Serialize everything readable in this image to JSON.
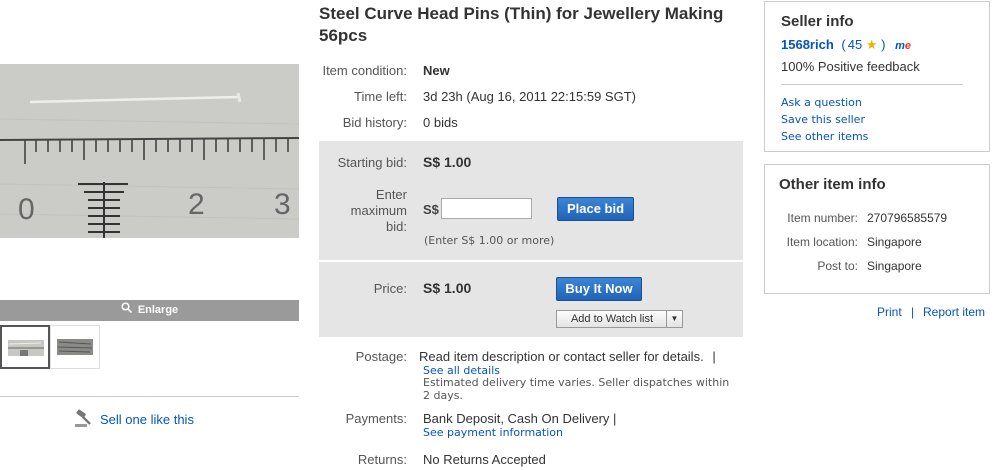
{
  "left": {
    "enlarge_label": "Enlarge",
    "sell_label": "Sell one like this"
  },
  "item": {
    "title": "Steel Curve Head Pins (Thin) for Jewellery Making 56pcs",
    "condition_label": "Item condition:",
    "condition_value": "New",
    "time_left_label": "Time left:",
    "time_left_value": "3d 23h (Aug 16, 2011 22:15:59 SGT)",
    "bid_history_label": "Bid history:",
    "bid_history_value": "0 bids"
  },
  "bid": {
    "starting_label": "Starting bid:",
    "starting_value": "S$ 1.00",
    "enter_label_1": "Enter",
    "enter_label_2": "maximum",
    "enter_label_3": "bid:",
    "currency": "S$",
    "input_value": "",
    "hint": "(Enter S$ 1.00 or more)",
    "place_bid": "Place bid"
  },
  "price": {
    "label": "Price:",
    "value": "S$ 1.00",
    "buy_now": "Buy It Now",
    "watch": "Add to Watch list"
  },
  "postage": {
    "label": "Postage:",
    "value": "Read item description or contact seller for details.",
    "sep": "|",
    "link": "See all details",
    "note": "Estimated delivery time varies. Seller dispatches within 2 days."
  },
  "payments": {
    "label": "Payments:",
    "value": "Bank Deposit, Cash On Delivery |",
    "link": "See payment information"
  },
  "returns": {
    "label": "Returns:",
    "value": "No Returns Accepted"
  },
  "seller": {
    "heading": "Seller info",
    "name": "1568rich",
    "paren_open": "(",
    "score": "45",
    "star": "★",
    "paren_close": ")",
    "me_badge": "me",
    "feedback": "100% Positive feedback",
    "links": [
      "Ask a question",
      "Save this seller",
      "See other items"
    ]
  },
  "other": {
    "heading": "Other item info",
    "number_label": "Item number:",
    "number_value": "270796585579",
    "location_label": "Item location:",
    "location_value": "Singapore",
    "post_label": "Post to:",
    "post_value": "Singapore"
  },
  "footer": {
    "print": "Print",
    "sep": "|",
    "report": "Report item"
  },
  "colors": {
    "link": "#0654ba",
    "panel": "#e5e5e5",
    "button": "#1f63b8"
  }
}
